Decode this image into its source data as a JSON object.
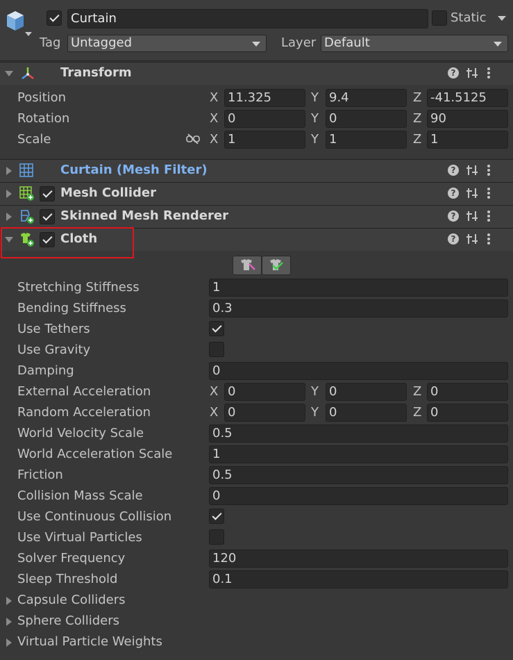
{
  "object": {
    "name": "Curtain",
    "active": true,
    "static_label": "Static",
    "static_checked": false,
    "tag_label": "Tag",
    "tag_value": "Untagged",
    "layer_label": "Layer",
    "layer_value": "Default"
  },
  "transform": {
    "title": "Transform",
    "rows": [
      {
        "label": "Position",
        "x": "11.325",
        "y": "9.4",
        "z": "-41.5125"
      },
      {
        "label": "Rotation",
        "x": "0",
        "y": "0",
        "z": "90"
      },
      {
        "label": "Scale",
        "x": "1",
        "y": "1",
        "z": "1"
      }
    ],
    "axis_x": "X",
    "axis_y": "Y",
    "axis_z": "Z"
  },
  "components": {
    "mesh_filter": {
      "title": "Curtain (Mesh Filter)"
    },
    "mesh_collider": {
      "title": "Mesh Collider",
      "enabled": true
    },
    "skinned_mesh_renderer": {
      "title": "Skinned Mesh Renderer",
      "enabled": true
    },
    "cloth": {
      "title": "Cloth",
      "enabled": true
    }
  },
  "cloth_props": {
    "stretching_stiffness": {
      "label": "Stretching Stiffness",
      "value": "1"
    },
    "bending_stiffness": {
      "label": "Bending Stiffness",
      "value": "0.3"
    },
    "use_tethers": {
      "label": "Use Tethers",
      "checked": true
    },
    "use_gravity": {
      "label": "Use Gravity",
      "checked": false
    },
    "damping": {
      "label": "Damping",
      "value": "0"
    },
    "external_acceleration": {
      "label": "External Acceleration",
      "x": "0",
      "y": "0",
      "z": "0"
    },
    "random_acceleration": {
      "label": "Random Acceleration",
      "x": "0",
      "y": "0",
      "z": "0"
    },
    "world_velocity_scale": {
      "label": "World Velocity Scale",
      "value": "0.5"
    },
    "world_acceleration_scale": {
      "label": "World Acceleration Scale",
      "value": "1"
    },
    "friction": {
      "label": "Friction",
      "value": "0.5"
    },
    "collision_mass_scale": {
      "label": "Collision Mass Scale",
      "value": "0"
    },
    "use_continuous_collision": {
      "label": "Use Continuous Collision",
      "checked": true
    },
    "use_virtual_particles": {
      "label": "Use Virtual Particles",
      "checked": false
    },
    "solver_frequency": {
      "label": "Solver Frequency",
      "value": "120"
    },
    "sleep_threshold": {
      "label": "Sleep Threshold",
      "value": "0.1"
    },
    "capsule_colliders": {
      "label": "Capsule Colliders"
    },
    "sphere_colliders": {
      "label": "Sphere Colliders"
    },
    "virtual_particle_weights": {
      "label": "Virtual Particle Weights"
    }
  },
  "colors": {
    "background": "#383838",
    "header": "#3e3e3e",
    "field": "#2a2a2a",
    "link_blue": "#7fb2f0",
    "highlight_red": "#e0161c",
    "cloth_green": "#8bd43e"
  },
  "icons": [
    "gameobject-cube-icon",
    "transform-axes-icon",
    "mesh-filter-grid-icon",
    "mesh-collider-icon",
    "skinned-mesh-renderer-icon",
    "cloth-icon",
    "help-icon",
    "preset-icon",
    "kebab-menu-icon",
    "unlink-scale-icon",
    "paint-constraints-icon",
    "select-particles-icon"
  ]
}
